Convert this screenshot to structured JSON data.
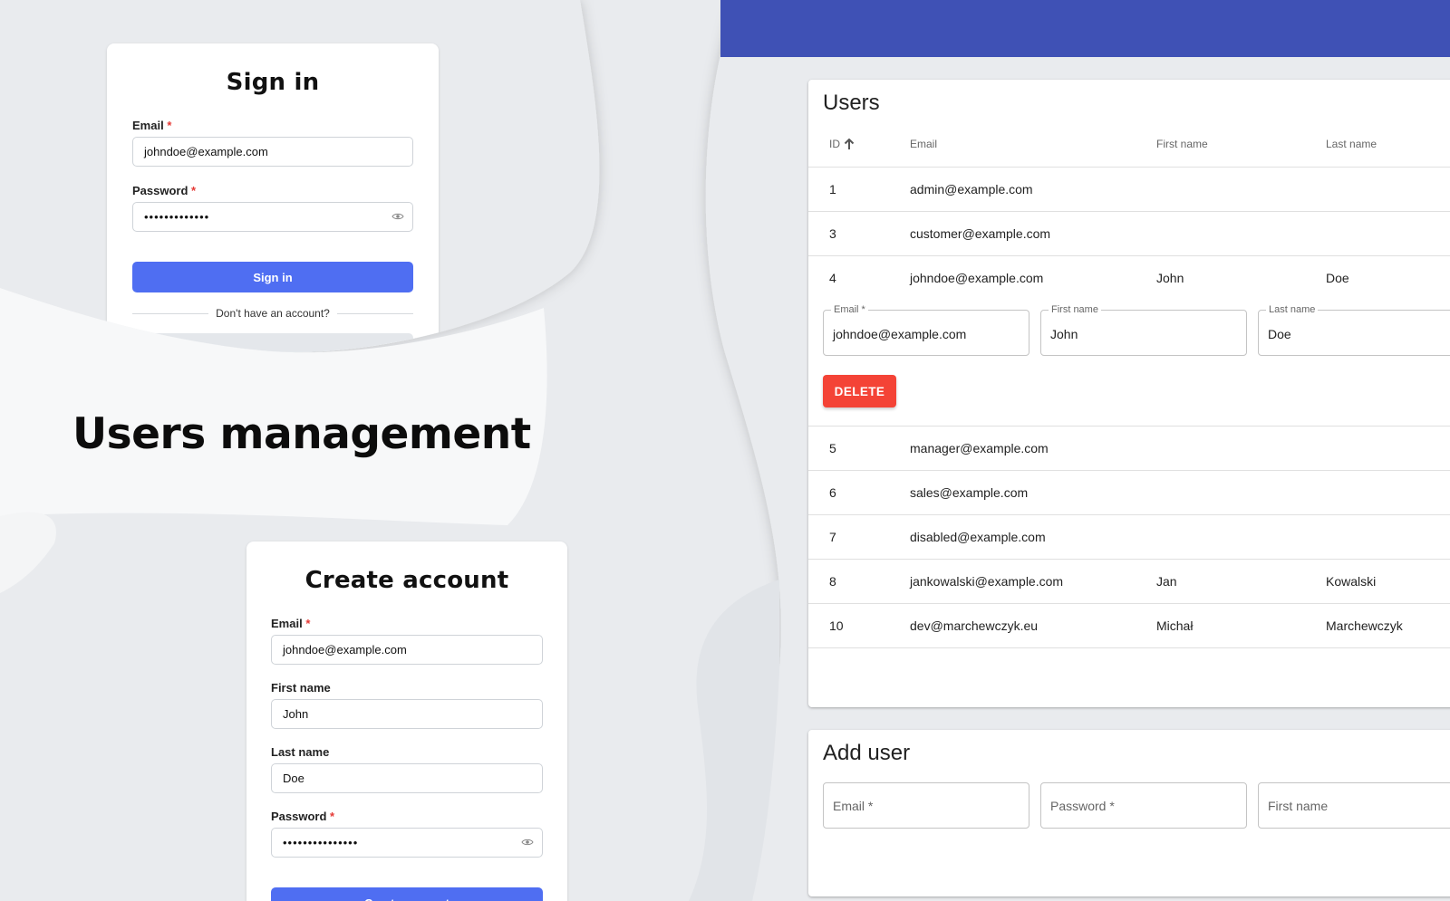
{
  "headline": "Users management",
  "signin": {
    "title": "Sign in",
    "email_label": "Email",
    "email_value": "johndoe@example.com",
    "password_label": "Password",
    "password_value": "•••••••••••••",
    "required_mark": "*",
    "submit_label": "Sign in",
    "no_account_text": "Don't have an account?"
  },
  "create_account": {
    "title": "Create account",
    "email_label": "Email",
    "email_value": "johndoe@example.com",
    "first_name_label": "First name",
    "first_name_value": "John",
    "last_name_label": "Last name",
    "last_name_value": "Doe",
    "password_label": "Password",
    "password_value": "•••••••••••••••",
    "required_mark": "*",
    "submit_label": "Create account"
  },
  "users_table": {
    "title": "Users",
    "columns": [
      "ID",
      "Email",
      "First name",
      "Last name"
    ],
    "sort_column": "ID",
    "rows": [
      {
        "id": "1",
        "email": "admin@example.com",
        "first_name": "",
        "last_name": ""
      },
      {
        "id": "3",
        "email": "customer@example.com",
        "first_name": "",
        "last_name": ""
      },
      {
        "id": "4",
        "email": "johndoe@example.com",
        "first_name": "John",
        "last_name": "Doe"
      },
      {
        "id": "5",
        "email": "manager@example.com",
        "first_name": "",
        "last_name": ""
      },
      {
        "id": "6",
        "email": "sales@example.com",
        "first_name": "",
        "last_name": ""
      },
      {
        "id": "7",
        "email": "disabled@example.com",
        "first_name": "",
        "last_name": ""
      },
      {
        "id": "8",
        "email": "jankowalski@example.com",
        "first_name": "Jan",
        "last_name": "Kowalski"
      },
      {
        "id": "10",
        "email": "dev@marchewczyk.eu",
        "first_name": "Michał",
        "last_name": "Marchewczyk"
      }
    ],
    "expanded_editor": {
      "email_label": "Email *",
      "email_value": "johndoe@example.com",
      "first_name_label": "First name",
      "first_name_value": "John",
      "last_name_label": "Last name",
      "last_name_value": "Doe",
      "delete_label": "DELETE"
    }
  },
  "add_user": {
    "title": "Add user",
    "email_placeholder": "Email *",
    "password_placeholder": "Password *",
    "first_name_placeholder": "First name"
  },
  "colors": {
    "app_bar": "#3f51b5",
    "primary_button": "#4f6ef2",
    "delete_button": "#f44336",
    "required": "#e53935"
  },
  "icons": {
    "password_toggle": "eye-icon",
    "sort": "arrow-up-icon"
  }
}
